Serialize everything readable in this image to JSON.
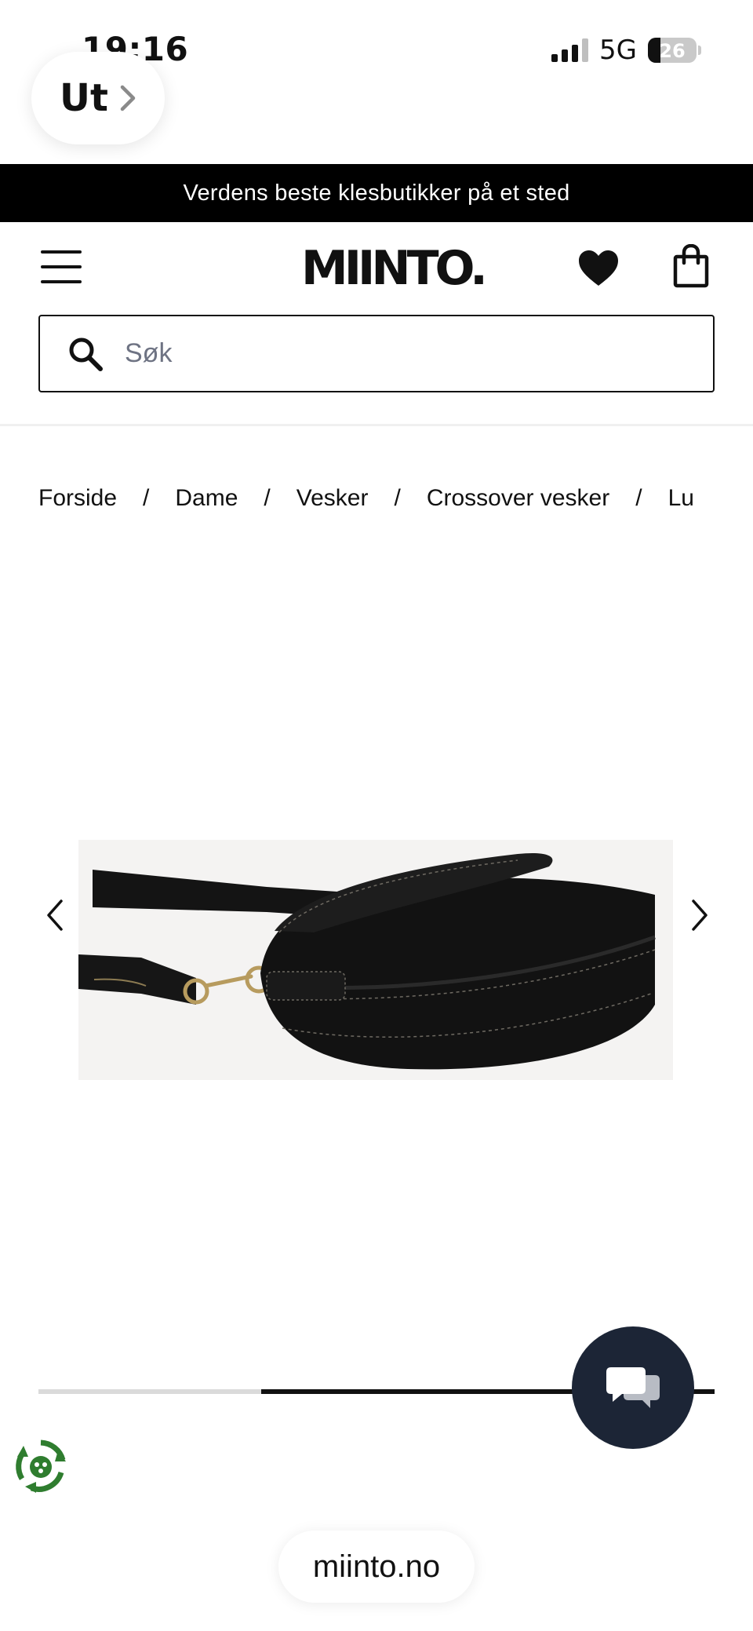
{
  "status_bar": {
    "time": "19:16",
    "network": "5G",
    "battery": "26",
    "battery_level": 0.26
  },
  "back": {
    "label": "Ut"
  },
  "announcement": {
    "text": "Verdens beste klesbutikker på et sted"
  },
  "header": {
    "logo": "MIINTO.",
    "menu_icon": "hamburger-menu-icon",
    "wishlist_icon": "heart-icon",
    "cart_icon": "shopping-bag-icon"
  },
  "search": {
    "placeholder": "Søk",
    "value": "",
    "icon": "search-icon"
  },
  "breadcrumb": {
    "items": [
      "Forside",
      "Dame",
      "Vesker",
      "Crossover vesker",
      "Lu"
    ],
    "separator": "/"
  },
  "gallery": {
    "image": "black leather half-moon crossbody bag with gold clasp",
    "prev_icon": "chevron-left-icon",
    "next_icon": "chevron-right-icon",
    "progress": 0.67
  },
  "chat": {
    "icon": "chat-bubbles-icon"
  },
  "eco": {
    "icon": "recycle-badge-icon"
  },
  "url_bar": {
    "text": "miinto.no"
  },
  "colors": {
    "announcement_bg": "#000000",
    "chat_bg": "#1c2536",
    "eco_green": "#2f7d2f"
  }
}
